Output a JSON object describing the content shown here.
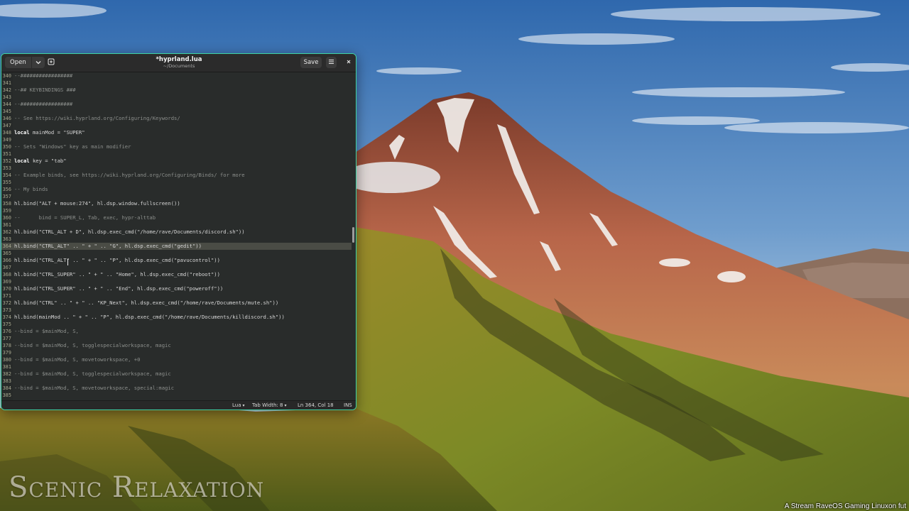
{
  "desktop": {
    "watermark": "Scenic Relaxation",
    "stream_caption": "A Stream RaveOS Gaming Linuxon fut"
  },
  "editor": {
    "title": "*hyprland.lua",
    "subtitle": "~/Documents",
    "open_label": "Open",
    "save_label": "Save",
    "icons": {
      "open_dropdown": "chevron-down-icon",
      "new_tab": "new-tab-icon",
      "menu": "hamburger-menu-icon",
      "close": "close-icon"
    },
    "status": {
      "language": "Lua",
      "tab_width": "Tab Width: 8",
      "position": "Ln 364, Col 18",
      "mode": "INS"
    },
    "current_line": "364",
    "lines": [
      {
        "n": "340",
        "t": "--#################"
      },
      {
        "n": "341",
        "t": ""
      },
      {
        "n": "342",
        "t": "--## KEYBINDINGS ###"
      },
      {
        "n": "343",
        "t": ""
      },
      {
        "n": "344",
        "t": "--#################"
      },
      {
        "n": "345",
        "t": ""
      },
      {
        "n": "346",
        "t": "-- See https://wiki.hyprland.org/Configuring/Keywords/"
      },
      {
        "n": "347",
        "t": ""
      },
      {
        "n": "348",
        "t": "local mainMod = \"SUPER\""
      },
      {
        "n": "349",
        "t": ""
      },
      {
        "n": "350",
        "t": "-- Sets \"Windows\" key as main modifier"
      },
      {
        "n": "351",
        "t": ""
      },
      {
        "n": "352",
        "t": "local key = \"tab\""
      },
      {
        "n": "353",
        "t": ""
      },
      {
        "n": "354",
        "t": "-- Example binds, see https://wiki.hyprland.org/Configuring/Binds/ for more"
      },
      {
        "n": "355",
        "t": ""
      },
      {
        "n": "356",
        "t": "-- My binds"
      },
      {
        "n": "357",
        "t": ""
      },
      {
        "n": "358",
        "t": "hl.bind(\"ALT + mouse:274\", hl.dsp.window.fullscreen())"
      },
      {
        "n": "359",
        "t": ""
      },
      {
        "n": "360",
        "t": "--      bind = SUPER_L, Tab, exec, hypr-alttab"
      },
      {
        "n": "361",
        "t": ""
      },
      {
        "n": "362",
        "t": "hl.bind(\"CTRL_ALT + D\", hl.dsp.exec_cmd(\"/home/rave/Documents/discord.sh\"))"
      },
      {
        "n": "363",
        "t": ""
      },
      {
        "n": "364",
        "t": "hl.bind(\"CTRL_ALT\" .. \" + \" .. \"G\", hl.dsp.exec_cmd(\"gedit\"))"
      },
      {
        "n": "365",
        "t": ""
      },
      {
        "n": "366",
        "t": "hl.bind(\"CTRL_ALT\" .. \" + \" .. \"P\", hl.dsp.exec_cmd(\"pavucontrol\"))"
      },
      {
        "n": "367",
        "t": ""
      },
      {
        "n": "368",
        "t": "hl.bind(\"CTRL_SUPER\" .. \" + \" .. \"Home\", hl.dsp.exec_cmd(\"reboot\"))"
      },
      {
        "n": "369",
        "t": ""
      },
      {
        "n": "370",
        "t": "hl.bind(\"CTRL_SUPER\" .. \" + \" .. \"End\", hl.dsp.exec_cmd(\"poweroff\"))"
      },
      {
        "n": "371",
        "t": ""
      },
      {
        "n": "372",
        "t": "hl.bind(\"CTRL\" .. \" + \" .. \"KP_Next\", hl.dsp.exec_cmd(\"/home/rave/Documents/mute.sh\"))"
      },
      {
        "n": "373",
        "t": ""
      },
      {
        "n": "374",
        "t": "hl.bind(mainMod .. \" + \" .. \"P\", hl.dsp.exec_cmd(\"/home/rave/Documents/killdiscord.sh\"))"
      },
      {
        "n": "375",
        "t": ""
      },
      {
        "n": "376",
        "t": "--bind = $mainMod, S,"
      },
      {
        "n": "377",
        "t": ""
      },
      {
        "n": "378",
        "t": "--bind = $mainMod, S, togglespecialworkspace, magic"
      },
      {
        "n": "379",
        "t": ""
      },
      {
        "n": "380",
        "t": "--bind = $mainMod, S, movetoworkspace, +0"
      },
      {
        "n": "381",
        "t": ""
      },
      {
        "n": "382",
        "t": "--bind = $mainMod, S, togglespecialworkspace, magic"
      },
      {
        "n": "383",
        "t": ""
      },
      {
        "n": "384",
        "t": "--bind = $mainMod, S, movetoworkspace, special:magic"
      },
      {
        "n": "385",
        "t": ""
      }
    ]
  }
}
